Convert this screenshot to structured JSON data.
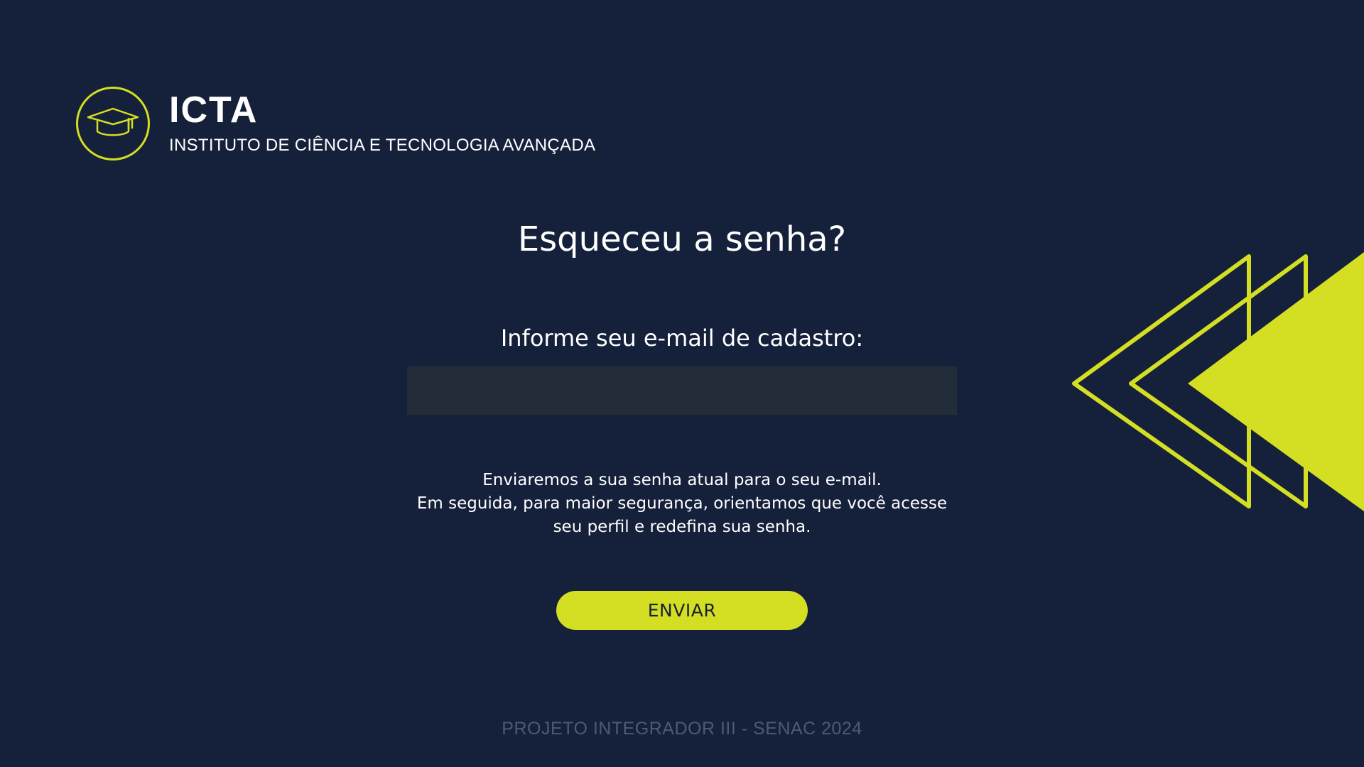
{
  "brand": {
    "logo_icon": "graduation-cap-icon",
    "title": "ICTA",
    "subtitle": "INSTITUTO DE CIÊNCIA E TECNOLOGIA AVANÇADA"
  },
  "main": {
    "title": "Esqueceu a senha?",
    "email_label": "Informe seu e-mail de cadastro:",
    "email_value": "",
    "email_placeholder": "",
    "info_lines": [
      "Enviaremos a sua senha atual para o seu e-mail.",
      "Em seguida, para maior segurança, orientamos que você acesse",
      "seu perfil e redefina sua senha."
    ],
    "submit_label": "ENVIAR"
  },
  "footer": {
    "text": "PROJETO INTEGRADOR III - SENAC 2024"
  },
  "colors": {
    "background": "#15203a",
    "accent": "#d4de23",
    "input_background": "#232d39",
    "footer_text": "#4f5a71"
  }
}
